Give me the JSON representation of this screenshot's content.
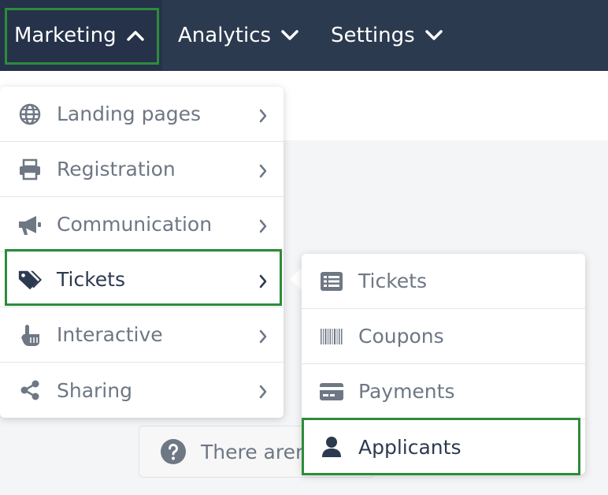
{
  "navbar": {
    "items": [
      {
        "label": "Marketing",
        "expanded": true,
        "icon": "chevron-up-icon"
      },
      {
        "label": "Analytics",
        "expanded": false,
        "icon": "chevron-down-icon"
      },
      {
        "label": "Settings",
        "expanded": false,
        "icon": "chevron-down-icon"
      }
    ]
  },
  "marketing_menu": {
    "items": [
      {
        "label": "Landing pages",
        "icon": "globe-icon"
      },
      {
        "label": "Registration",
        "icon": "printer-icon"
      },
      {
        "label": "Communication",
        "icon": "megaphone-icon"
      },
      {
        "label": "Tickets",
        "icon": "tags-icon",
        "active": true
      },
      {
        "label": "Interactive",
        "icon": "hand-pointer-icon"
      },
      {
        "label": "Sharing",
        "icon": "share-icon"
      }
    ]
  },
  "tickets_submenu": {
    "items": [
      {
        "label": "Tickets",
        "icon": "list-icon"
      },
      {
        "label": "Coupons",
        "icon": "barcode-icon"
      },
      {
        "label": "Payments",
        "icon": "credit-card-icon"
      },
      {
        "label": "Applicants",
        "icon": "user-icon",
        "active": true
      }
    ]
  },
  "notice": {
    "text": "There arer",
    "icon": "question-circle-icon"
  },
  "colors": {
    "navbar": "#2c3a50",
    "highlight": "#2e8b3a",
    "muted_text": "#6e7784",
    "active_text": "#2c3a50"
  }
}
